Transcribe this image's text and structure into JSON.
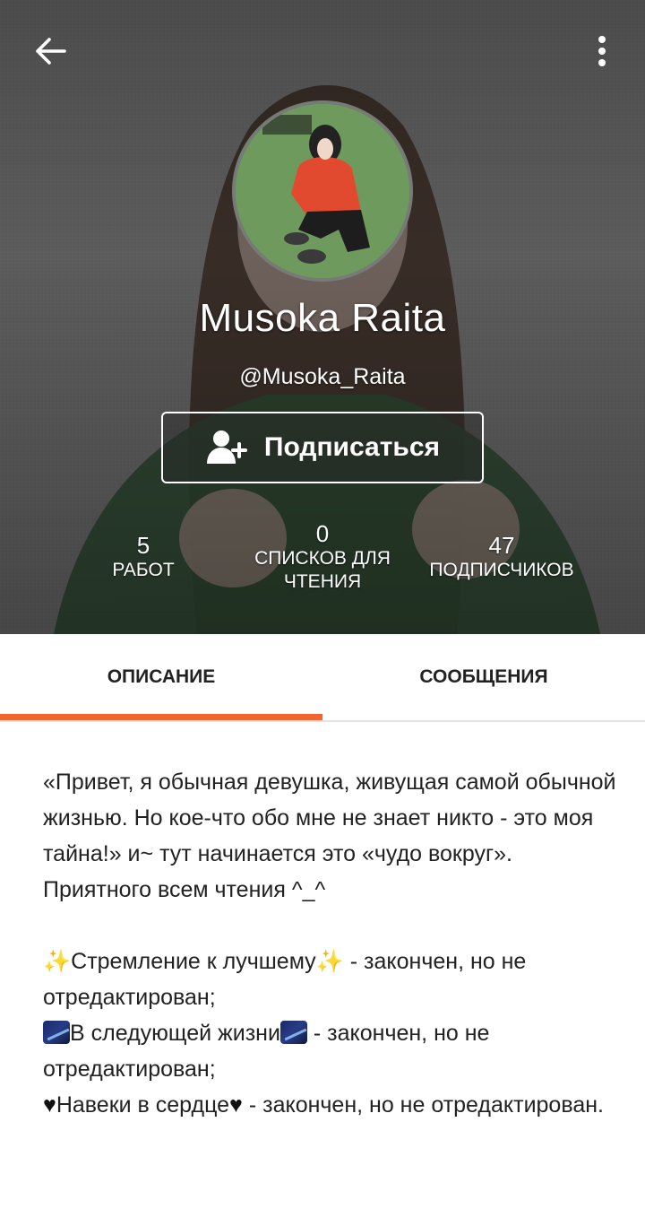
{
  "header": {
    "back_icon": "arrow-left-icon",
    "more_icon": "more-vertical-icon"
  },
  "profile": {
    "display_name": "Musoka Raita",
    "username": "@Musoka_Raita",
    "follow_label": "Подписаться",
    "follow_icon": "add-user-icon"
  },
  "stats": {
    "works": {
      "value": "5",
      "label": "РАБОТ"
    },
    "reading_lists": {
      "value": "0",
      "label": "СПИСКОВ ДЛЯ ЧТЕНИЯ"
    },
    "followers": {
      "value": "47",
      "label": "ПОДПИСЧИКОВ"
    }
  },
  "tabs": {
    "about": "ОПИСАНИЕ",
    "messages": "СООБЩЕНИЯ",
    "active_color": "#f4642c"
  },
  "description": {
    "intro": "«Привет, я обычная девушка, живущая самой обычной жизнью. Но кое-что обо мне не знает никто - это моя тайна!» и~ тут начинается это «чудо вокруг».",
    "greeting": "Приятного всем чтения ^_^",
    "works": [
      {
        "title": "Стремление к лучшему",
        "status": " - закончен, но не отредактирован;",
        "emoji": "sparkles"
      },
      {
        "title": "В следующей жизни",
        "status": " - закончен, но не отредактирован;",
        "emoji": "milky-way"
      },
      {
        "title": "Навеки в сердце",
        "status": " - закончен, но не отредактирован.",
        "emoji": "heart"
      }
    ]
  }
}
